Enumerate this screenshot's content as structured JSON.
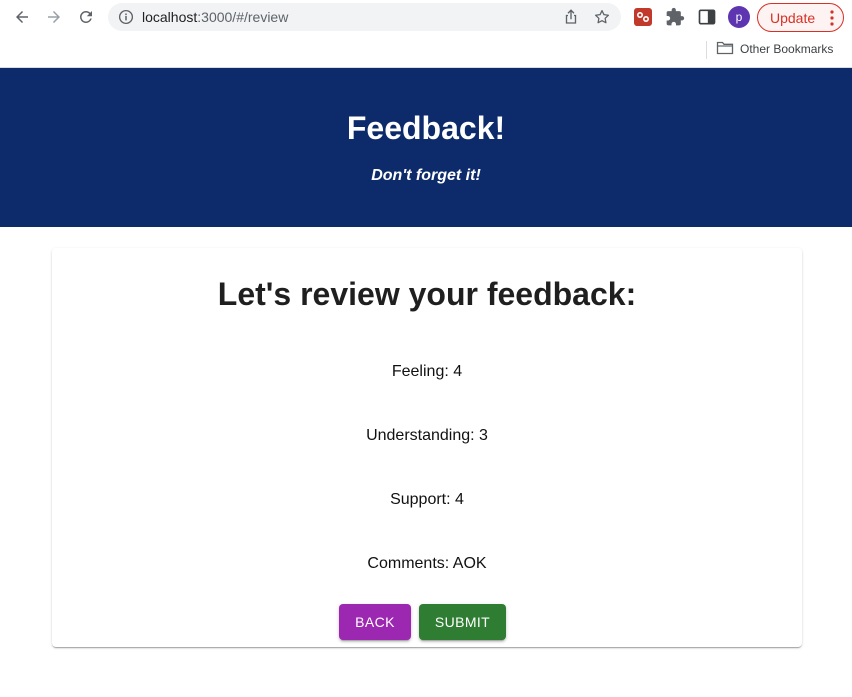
{
  "browser": {
    "url_host": "localhost",
    "url_path": ":3000/#/review",
    "profile_initial": "p",
    "update_label": "Update",
    "bookmark_folder": "Other Bookmarks"
  },
  "header": {
    "title": "Feedback!",
    "subtitle": "Don't forget it!",
    "background": "#0d2b6b"
  },
  "review": {
    "title": "Let's review your feedback:",
    "items": [
      {
        "text": "Feeling: 4"
      },
      {
        "text": "Understanding: 3"
      },
      {
        "text": "Support: 4"
      },
      {
        "text": "Comments: AOK"
      }
    ],
    "back_label": "BACK",
    "submit_label": "SUBMIT",
    "back_color": "#9c27b0",
    "submit_color": "#2e7d32"
  },
  "icons": [
    "back-arrow-icon",
    "forward-arrow-icon",
    "reload-icon",
    "info-icon",
    "share-icon",
    "star-icon",
    "extension-icon",
    "puzzle-icon",
    "side-panel-icon",
    "more-vert-icon",
    "folder-icon"
  ]
}
